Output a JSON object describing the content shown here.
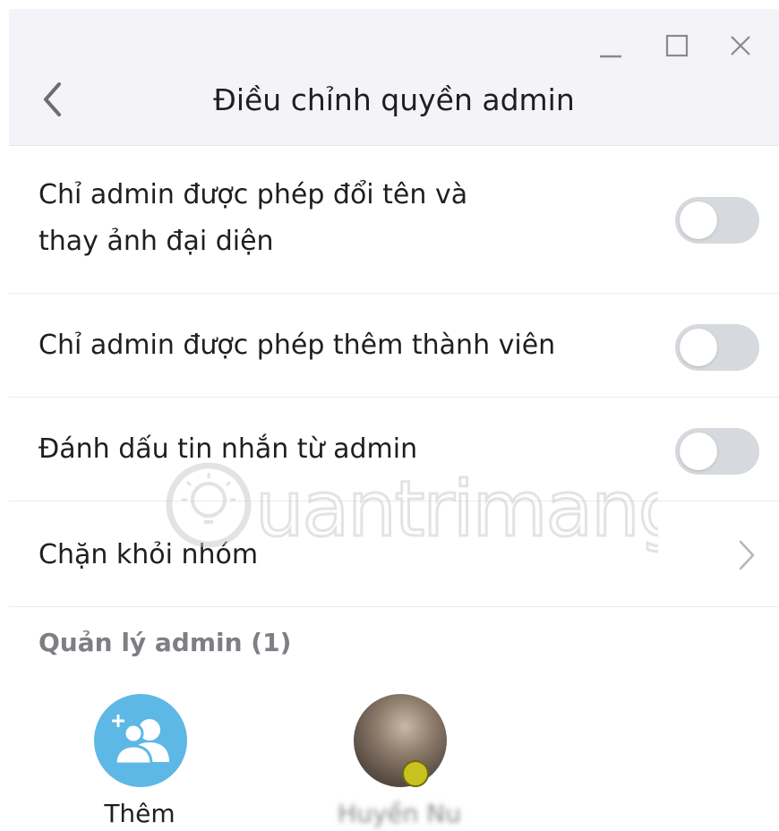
{
  "header": {
    "title": "Điều chỉnh quyền admin",
    "back_icon": "chevron-left-icon",
    "window_controls": [
      "minimize-icon",
      "maximize-icon",
      "close-icon"
    ]
  },
  "settings": {
    "rename_avatar": {
      "line1": "Chỉ admin được phép đổi tên và",
      "line2": "thay ảnh đại diện",
      "enabled": false
    },
    "add_member": {
      "label": "Chỉ admin được phép thêm thành viên",
      "enabled": false
    },
    "mark_messages": {
      "label": "Đánh dấu tin nhắn từ admin",
      "enabled": false
    },
    "block": {
      "label": "Chặn khỏi nhóm",
      "icon": "chevron-right-icon"
    }
  },
  "admin_section": {
    "title": "Quản lý admin (1)",
    "add_label": "Thêm",
    "admin_name": "Huyền Nu"
  },
  "watermark": {
    "text": "uantrimang"
  },
  "colors": {
    "header_bg": "#f4f4f8",
    "toggle_off": "#d6d9dd",
    "add_avatar": "#5db8e5",
    "section_title": "#7d7f85"
  }
}
